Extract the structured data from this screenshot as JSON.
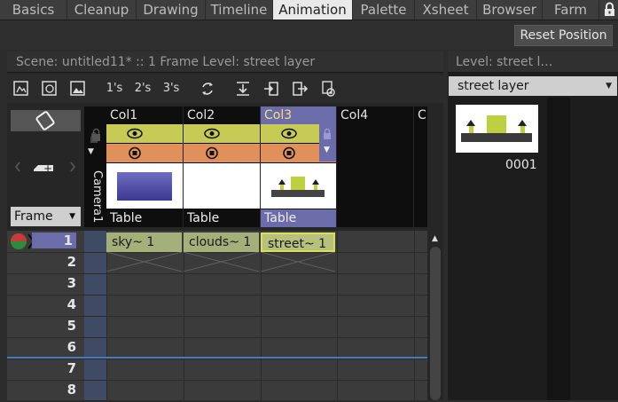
{
  "rooms": [
    "Basics",
    "Cleanup",
    "Drawing",
    "Timeline",
    "Animation",
    "Palette",
    "Xsheet",
    "Browser",
    "Farm"
  ],
  "active_room": "Animation",
  "toolbar": {
    "reset_label": "Reset Position"
  },
  "xsheet": {
    "title": "Scene: untitled11*   ::   1 Frame  Level: street layer",
    "tools": [
      "1's",
      "2's",
      "3's"
    ],
    "frame_mode": "Frame",
    "camera_label": "Camera1",
    "columns": [
      {
        "name": "Col1",
        "type": "Table",
        "cell": "sky~ 1"
      },
      {
        "name": "Col2",
        "type": "Table",
        "cell": "clouds~ 1"
      },
      {
        "name": "Col3",
        "type": "Table",
        "cell": "street~ 1"
      },
      {
        "name": "Col4",
        "type": "",
        "cell": ""
      },
      {
        "name": "C",
        "type": "",
        "cell": ""
      }
    ],
    "rows": [
      "1",
      "2",
      "3",
      "4",
      "5",
      "6",
      "7",
      "8"
    ]
  },
  "level_strip": {
    "title": "Level:   street l…",
    "selected_level": "street layer",
    "frame_label": "0001"
  },
  "colors": {
    "active_tab": "#e9e9e9",
    "preview_on": "#c6cb55",
    "camstand_on": "#e0905a",
    "selected_column": "#6c6cab",
    "cell_sky": "#a3b07a",
    "cell_street": "#b7c07c"
  }
}
